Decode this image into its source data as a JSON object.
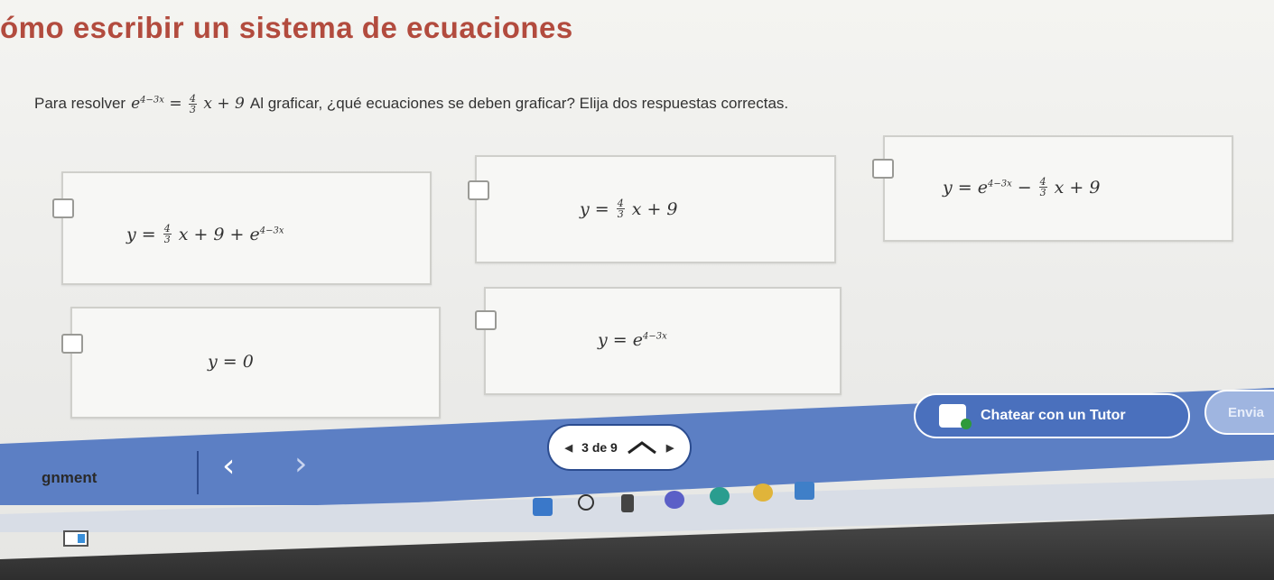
{
  "title": "ómo escribir un sistema de ecuaciones",
  "question": {
    "prefix": "Para resolver",
    "equation_lhs": "e",
    "equation_lhs_exp": "4−3x",
    "equals": "=",
    "frac_num": "4",
    "frac_den": "3",
    "equation_rhs_tail": "x + 9",
    "suffix": "Al graficar, ¿qué ecuaciones se deben graficar? Elija dos respuestas correctas."
  },
  "options": [
    {
      "lhs": "y =",
      "frac_num": "4",
      "frac_den": "3",
      "mid": "x + 9 + e",
      "exp": "4−3x"
    },
    {
      "lhs": "y =",
      "frac_num": "4",
      "frac_den": "3",
      "mid": "x + 9",
      "exp": ""
    },
    {
      "lhs": "y = e",
      "exp": "4−3x",
      "sep": "−",
      "frac_num": "4",
      "frac_den": "3",
      "mid": "x + 9"
    },
    {
      "lhs": "y = 0"
    },
    {
      "lhs": "y = e",
      "exp": "4−3x"
    }
  ],
  "nav": {
    "assignment_label": "gnment",
    "prev_symbol": "‹",
    "next_symbol": "›",
    "pager_text": "3 de 9",
    "pager_left_tri": "◀",
    "pager_right_tri": "▶",
    "chat_label": "Chatear con un Tutor",
    "send_label": "Envia"
  },
  "colors": {
    "title": "#b24b3e",
    "nav_blue": "#5c7fc4",
    "button_blue": "#4a70bd"
  }
}
